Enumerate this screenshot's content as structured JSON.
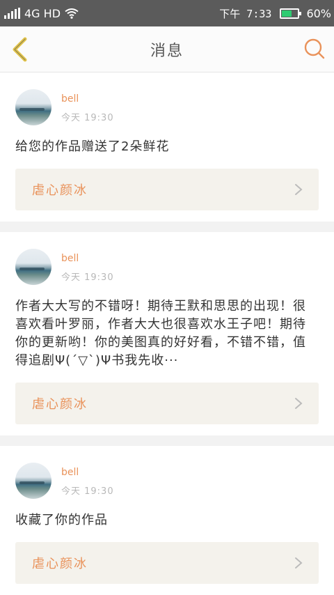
{
  "status_bar": {
    "network": "4G HD",
    "time": "下午 7:33",
    "battery_percent": "60%",
    "battery_level": 0.6,
    "battery_color": "#2ecc71"
  },
  "nav": {
    "title": "消息",
    "back_icon": "back-chevron-icon",
    "search_icon": "search-icon",
    "accent_color": "#e9925a"
  },
  "messages": [
    {
      "username": "bell",
      "time": "今天 19:30",
      "content": "给您的作品赠送了2朵鲜花",
      "work_title": "虐心颜冰"
    },
    {
      "username": "bell",
      "time": "今天 19:30",
      "content": "作者大大写的不错呀！期待王默和思思的出现！很喜欢看叶罗丽，作者大大也很喜欢水王子吧！期待你的更新哟！你的美图真的好好看，不错不错，值得追剧Ψ(´▽`)Ψ书我先收···",
      "work_title": "虐心颜冰"
    },
    {
      "username": "bell",
      "time": "今天 19:30",
      "content": "收藏了你的作品",
      "work_title": "虐心颜冰"
    }
  ]
}
